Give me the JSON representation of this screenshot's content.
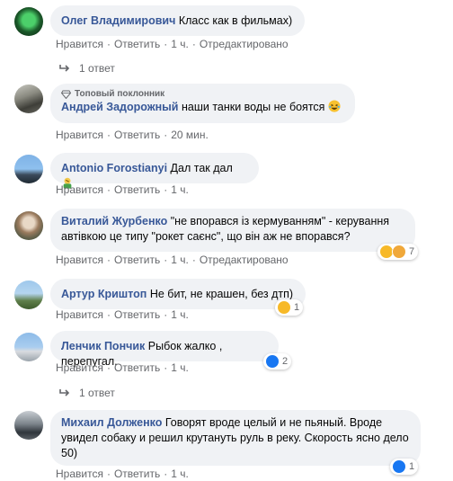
{
  "comments": [
    {
      "author": "Олег Владимирович",
      "text": "Класс как в фильмах)",
      "actions": {
        "like": "Нравится",
        "reply": "Ответить",
        "time": "1 ч.",
        "edited": "Отредактировано"
      },
      "replies": "1 ответ"
    },
    {
      "badge": "Топовый поклонник",
      "author": "Андрей Задорожный",
      "text": "наши танки воды не боятся",
      "actions": {
        "like": "Нравится",
        "reply": "Ответить",
        "time": "20 мин."
      }
    },
    {
      "author": "Antonio Forostianyi",
      "text": "Дал так дал",
      "actions": {
        "like": "Нравится",
        "reply": "Ответить",
        "time": "1 ч."
      }
    },
    {
      "author": "Виталий Журбенко",
      "text": "\"не впорався із кермуванням\" - керування автівкою це типу \"рокет саєнс\", що він аж не впорався?",
      "actions": {
        "like": "Нравится",
        "reply": "Ответить",
        "time": "1 ч.",
        "edited": "Отредактировано"
      },
      "reaction_count": "7"
    },
    {
      "author": "Артур Криштоп",
      "text": "Не бит, не крашен, без дтп)",
      "actions": {
        "like": "Нравится",
        "reply": "Ответить",
        "time": "1 ч."
      },
      "reaction_count": "1"
    },
    {
      "author": "Ленчик Пончик",
      "text": "Рыбок жалко , перепугал.",
      "actions": {
        "like": "Нравится",
        "reply": "Ответить",
        "time": "1 ч."
      },
      "reaction_count": "2",
      "replies": "1 ответ"
    },
    {
      "author": "Михаил Долженко",
      "text": "Говорят вроде целый и не пьяный. Вроде увидел собаку и решил крутануть руль в реку. Скорость ясно дело 50)",
      "actions": {
        "like": "Нравится",
        "reply": "Ответить",
        "time": "1 ч."
      },
      "reaction_count": "1"
    }
  ],
  "colors": {
    "author": "#385898",
    "bubble": "#f0f2f5",
    "meta": "#65676b",
    "like": "#1877f2",
    "haha": "#f7b928"
  },
  "icons": [
    "reply-arrow-icon",
    "top-fan-diamond-icon",
    "like-reaction-icon",
    "haha-reaction-icon",
    "sad-reaction-icon",
    "laughing-emoji-icon",
    "facepalm-emoji-icon"
  ]
}
